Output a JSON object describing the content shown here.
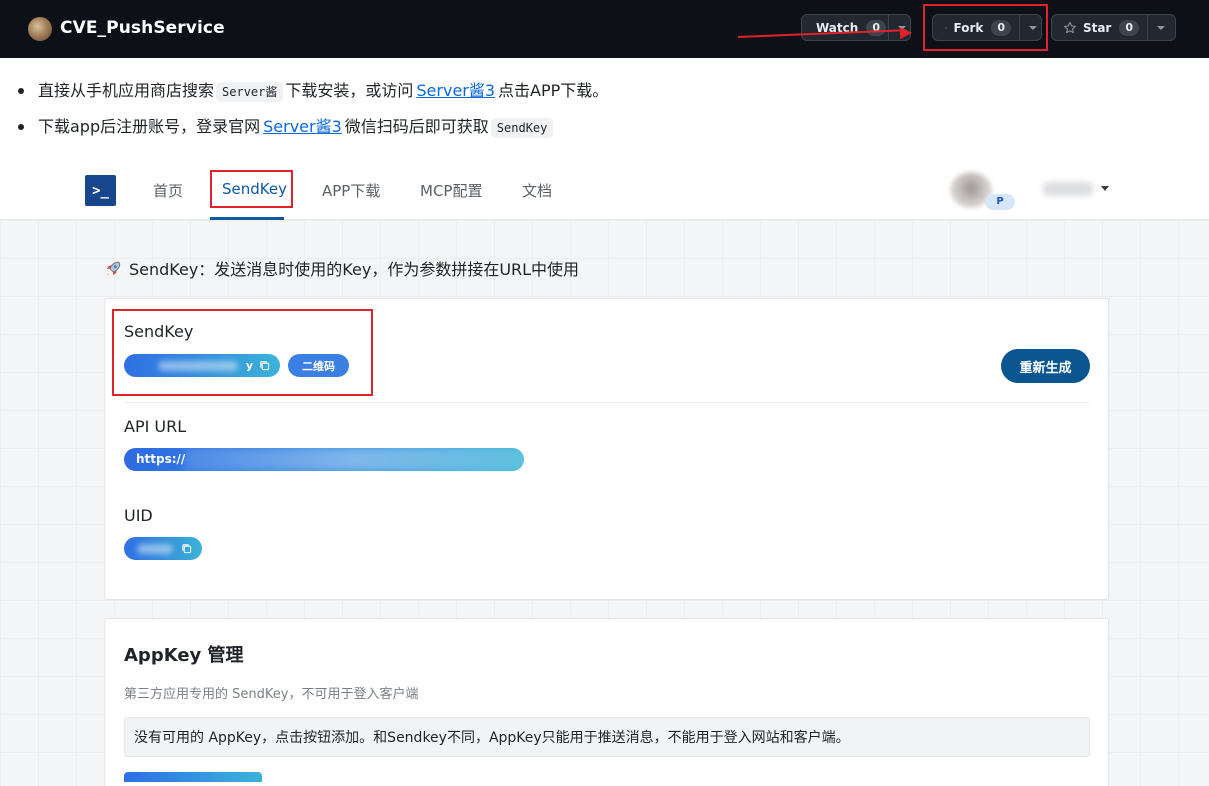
{
  "repo": {
    "title": "CVE_PushService",
    "watch_label": "Watch",
    "watch_count": "0",
    "fork_label": "Fork",
    "fork_count": "0",
    "star_label": "Star",
    "star_count": "0"
  },
  "bullets": [
    {
      "pre": "直接从手机应用商店搜索",
      "code": "Server酱",
      "mid": "下载安装，或访问",
      "link": "Server酱3",
      "post": "点击APP下载。"
    },
    {
      "pre": "下载app后注册账号，登录官网",
      "link": "Server酱3",
      "mid": "微信扫码后即可获取",
      "code": "SendKey"
    }
  ],
  "app": {
    "logo_text": ">_",
    "nav": [
      {
        "label": "首页"
      },
      {
        "label": "SendKey"
      },
      {
        "label": "APP下载"
      },
      {
        "label": "MCP配置"
      },
      {
        "label": "文档"
      }
    ],
    "avatar_badge": "P",
    "section_title": "SendKey：发送消息时使用的Key，作为参数拼接在URL中使用",
    "sendkey": {
      "label": "SendKey",
      "value_suffix": "y",
      "qr_button": "二维码",
      "regen_button": "重新生成"
    },
    "api": {
      "label": "API URL",
      "value_prefix": "https://"
    },
    "uid": {
      "label": "UID"
    },
    "appkey": {
      "title": "AppKey 管理",
      "subtitle": "第三方应用专用的 SendKey，不可用于登入客户端",
      "notice": "没有可用的 AppKey，点击按钮添加。和Sendkey不同，AppKey只能用于推送消息，不能用于登入网站和客户端。"
    }
  },
  "colors": {
    "github_header": "#0d1117",
    "annotation_red": "#e0222a",
    "link_blue": "#0969da",
    "app_primary": "#0e59a4",
    "regen_button": "#0b5690"
  }
}
